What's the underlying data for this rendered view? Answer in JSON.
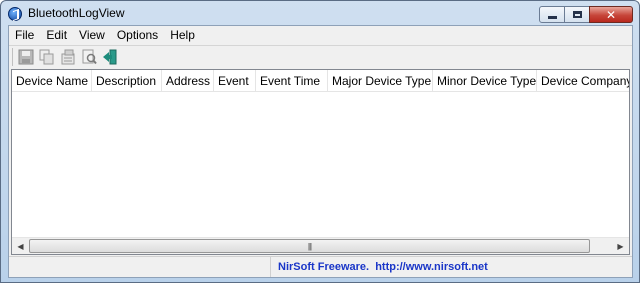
{
  "window": {
    "title": "BluetoothLogView",
    "close_glyph": "✕"
  },
  "menu": [
    "File",
    "Edit",
    "View",
    "Options",
    "Help"
  ],
  "toolbar": {
    "buttons": [
      "save-icon",
      "copy-icon",
      "properties-icon",
      "find-icon",
      "exit-icon"
    ]
  },
  "table": {
    "columns": [
      "Device Name",
      "Description",
      "Address",
      "Event",
      "Event Time",
      "Major Device Type",
      "Minor Device Type",
      "Device Company"
    ],
    "rows": []
  },
  "scrollbar": {
    "left_arrow": "◀",
    "right_arrow": "▶",
    "grip": "|||"
  },
  "status": {
    "left_text": "",
    "link_text": "NirSoft Freeware.  http://www.nirsoft.net",
    "link_color": "#1a36c8"
  }
}
